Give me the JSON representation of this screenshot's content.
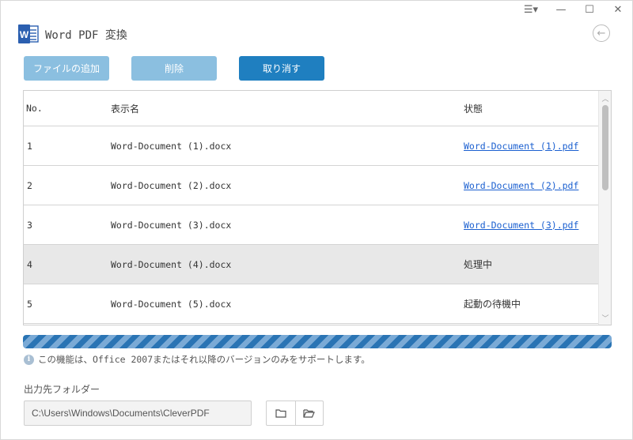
{
  "window": {
    "title": "Word PDF 変換",
    "controls": {
      "menu": "☰▾",
      "minimize": "—",
      "maximize": "☐",
      "close": "✕"
    },
    "back_symbol": "←"
  },
  "toolbar": {
    "add_label": "ファイルの追加",
    "delete_label": "削除",
    "cancel_label": "取り消す"
  },
  "table": {
    "headers": {
      "no": "No.",
      "name": "表示名",
      "status": "状態"
    },
    "rows": [
      {
        "no": "1",
        "name": "Word-Document (1).docx",
        "status": "Word-Document (1).pdf"
      },
      {
        "no": "2",
        "name": "Word-Document (2).docx",
        "status": "Word-Document (2).pdf"
      },
      {
        "no": "3",
        "name": "Word-Document (3).docx",
        "status": "Word-Document (3).pdf"
      },
      {
        "no": "4",
        "name": "Word-Document (4).docx",
        "status": "処理中"
      },
      {
        "no": "5",
        "name": "Word-Document (5).docx",
        "status": "起動の待機中"
      }
    ]
  },
  "progress": {
    "value_percent": 100
  },
  "info": {
    "icon": "info-icon",
    "text": "この機能は、Office 2007またはそれ以降のバージョンのみをサポートします。"
  },
  "output": {
    "label": "出力先フォルダー",
    "path": "C:\\Users\\Windows\\Documents\\CleverPDF"
  },
  "colors": {
    "accent": "#1f7fc0",
    "button_disabled": "#8bbfe0",
    "link": "#1a5fd0",
    "active_row": "#e8e8e8",
    "word_logo": "#2b5fb0"
  }
}
